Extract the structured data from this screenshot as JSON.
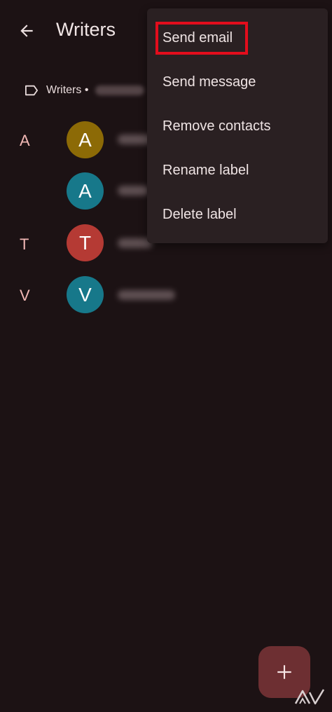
{
  "header": {
    "title": "Writers",
    "back_icon": "arrow-back-icon"
  },
  "label_chip": {
    "icon": "label-icon",
    "text": "Writers •"
  },
  "contacts": [
    {
      "section_letter": "A",
      "avatar_letter": "A",
      "avatar_color": "#8c6a06"
    },
    {
      "section_letter": "",
      "avatar_letter": "A",
      "avatar_color": "#17788a"
    },
    {
      "section_letter": "T",
      "avatar_letter": "T",
      "avatar_color": "#b53a34"
    },
    {
      "section_letter": "V",
      "avatar_letter": "V",
      "avatar_color": "#17788a"
    }
  ],
  "menu": {
    "items": [
      {
        "label": "Send email"
      },
      {
        "label": "Send message"
      },
      {
        "label": "Remove contacts"
      },
      {
        "label": "Rename label"
      },
      {
        "label": "Delete label"
      }
    ],
    "highlight_color": "#e30d1c"
  },
  "fab": {
    "icon": "plus-icon",
    "color": "#6d2f32"
  }
}
